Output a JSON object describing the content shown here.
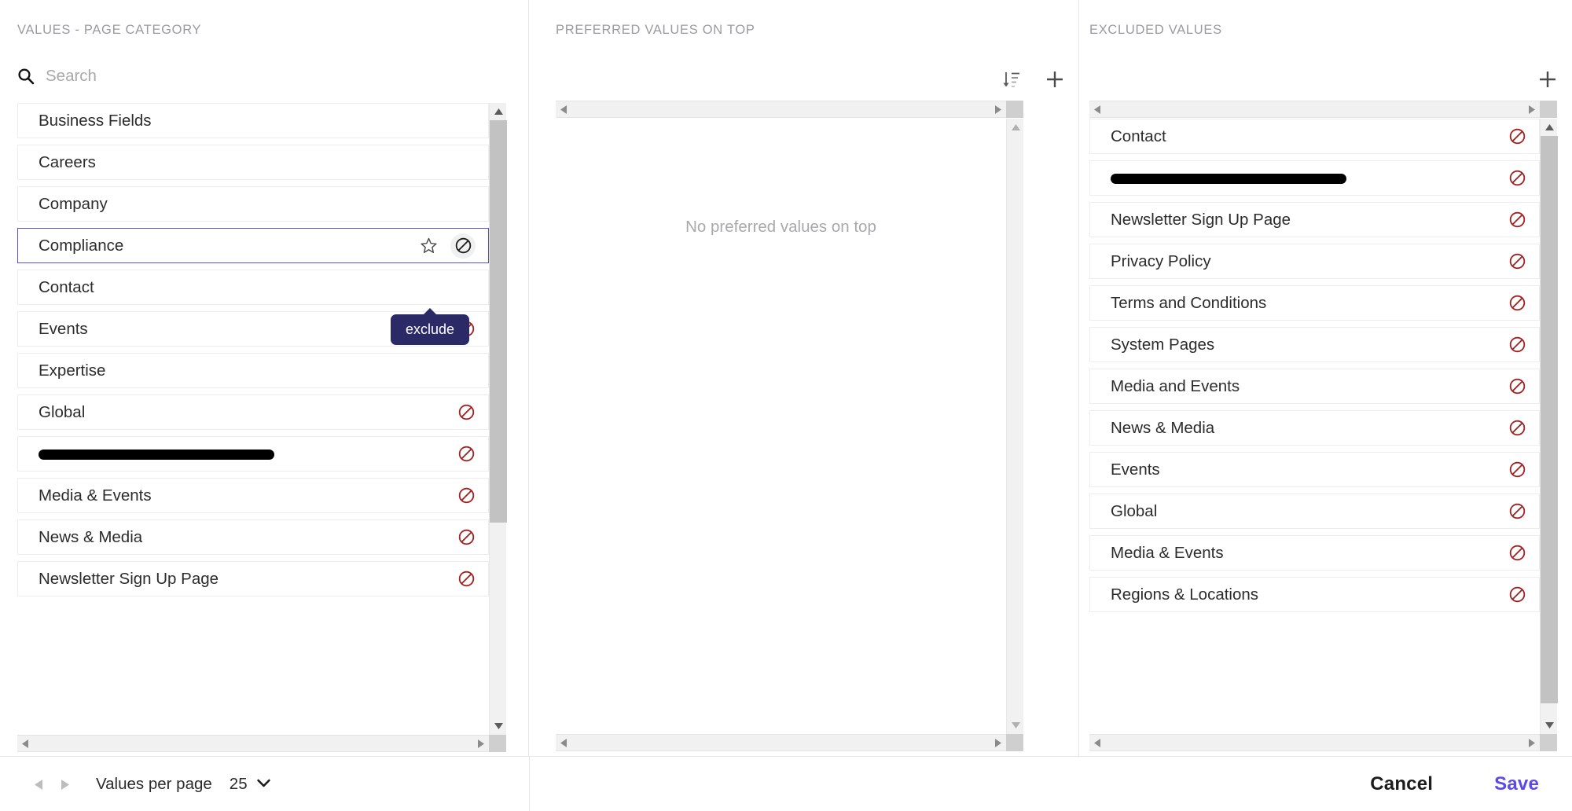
{
  "columns": {
    "left": {
      "title": "VALUES - PAGE CATEGORY",
      "search": {
        "placeholder": "Search",
        "value": ""
      },
      "items": [
        {
          "label": "Business Fields",
          "excludable": false,
          "redacted": false
        },
        {
          "label": "Careers",
          "excludable": false,
          "redacted": false
        },
        {
          "label": "Company",
          "excludable": false,
          "redacted": false
        },
        {
          "label": "Compliance",
          "excludable": true,
          "redacted": false,
          "selected": true
        },
        {
          "label": "Contact",
          "excludable": false,
          "redacted": false
        },
        {
          "label": "Events",
          "excludable": true,
          "redacted": false
        },
        {
          "label": "Expertise",
          "excludable": false,
          "redacted": false
        },
        {
          "label": "Global",
          "excludable": true,
          "redacted": false
        },
        {
          "label": "",
          "excludable": true,
          "redacted": true
        },
        {
          "label": "Media & Events",
          "excludable": true,
          "redacted": false
        },
        {
          "label": "News & Media",
          "excludable": true,
          "redacted": false
        },
        {
          "label": "Newsletter Sign Up Page",
          "excludable": true,
          "redacted": false
        }
      ],
      "selected_row": {
        "label": "Compliance",
        "prefer_icon": "star-icon",
        "exclude_icon": "exclude-icon",
        "tooltip": "exclude"
      }
    },
    "middle": {
      "title": "PREFERRED VALUES ON TOP",
      "empty_message": "No preferred values on top",
      "actions": [
        {
          "name": "sort-icon",
          "label": "sort"
        },
        {
          "name": "add-icon",
          "label": "add"
        }
      ],
      "items": []
    },
    "right": {
      "title": "EXCLUDED VALUES",
      "actions": [
        {
          "name": "add-icon",
          "label": "add"
        }
      ],
      "items": [
        {
          "label": "Contact",
          "redacted": false
        },
        {
          "label": "",
          "redacted": true
        },
        {
          "label": "Newsletter Sign Up Page",
          "redacted": false
        },
        {
          "label": "Privacy Policy",
          "redacted": false
        },
        {
          "label": "Terms and Conditions",
          "redacted": false
        },
        {
          "label": "System Pages",
          "redacted": false
        },
        {
          "label": "Media and Events",
          "redacted": false
        },
        {
          "label": "News & Media",
          "redacted": false
        },
        {
          "label": "Events",
          "redacted": false
        },
        {
          "label": "Global",
          "redacted": false
        },
        {
          "label": "Media & Events",
          "redacted": false
        },
        {
          "label": "Regions & Locations",
          "redacted": false
        }
      ]
    }
  },
  "footer": {
    "prev_label": "previous page",
    "next_label": "next page",
    "values_per_page_label": "Values per page",
    "values_per_page_value": "25",
    "cancel_label": "Cancel",
    "save_label": "Save"
  },
  "colors": {
    "accent": "#5b4ae8",
    "selected_border": "#5a52b5",
    "tooltip_bg": "#2b2a67",
    "exclude_red": "#a32020",
    "muted_text": "#9b9b9f"
  }
}
